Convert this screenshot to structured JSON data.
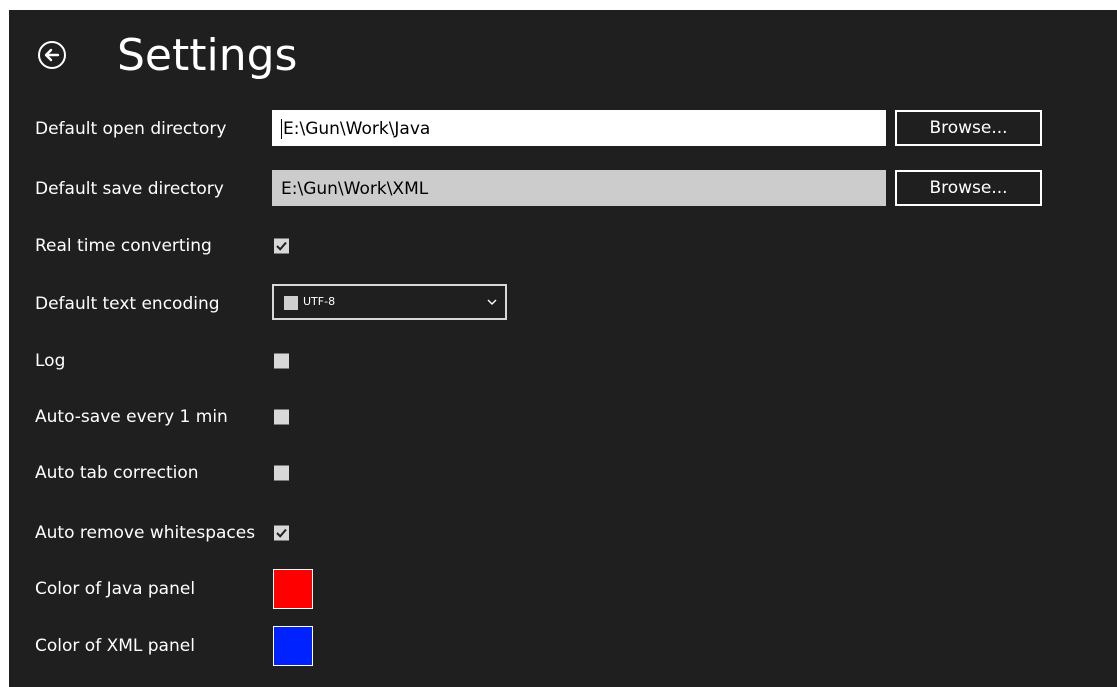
{
  "header": {
    "title": "Settings",
    "back_icon": "back-arrow-icon"
  },
  "settings": {
    "open_dir": {
      "label": "Default open directory",
      "value": "E:\\Gun\\Work\\Java",
      "button": "Browse..."
    },
    "save_dir": {
      "label": "Default save directory",
      "value": "E:\\Gun\\Work\\XML",
      "button": "Browse..."
    },
    "real_time": {
      "label": "Real time converting",
      "checked": true
    },
    "encoding": {
      "label": "Default text encoding",
      "value": "UTF-8"
    },
    "log": {
      "label": "Log",
      "checked": false
    },
    "autosave": {
      "label": "Auto-save every 1 min",
      "checked": false
    },
    "tab_correction": {
      "label": "Auto tab correction",
      "checked": false
    },
    "remove_ws": {
      "label": "Auto remove whitespaces",
      "checked": true
    },
    "java_color": {
      "label": "Color of Java panel",
      "color": "#ff0000"
    },
    "xml_color": {
      "label": "Color of XML panel",
      "color": "#0022ff"
    }
  },
  "colors": {
    "background": "#1f1f1f",
    "foreground": "#ffffff",
    "checkbox": "#d8d8d8"
  }
}
